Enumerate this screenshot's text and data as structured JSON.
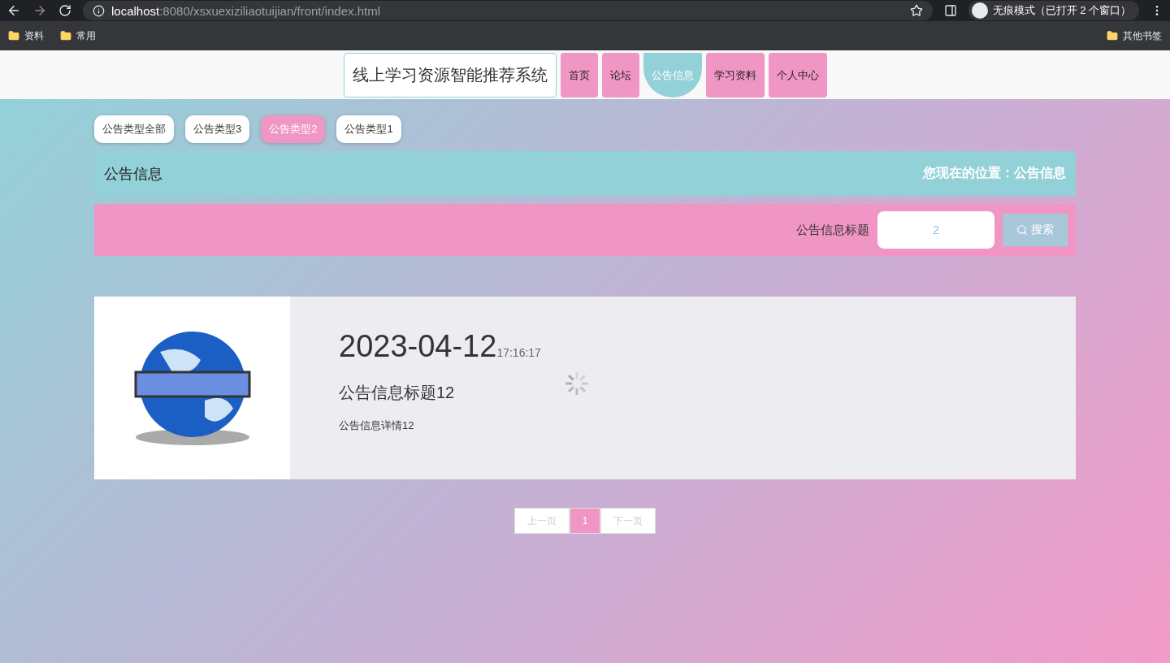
{
  "browser": {
    "url_host": "localhost",
    "url_path": ":8080/xsxuexiziliaotuijian/front/index.html",
    "incognito": "无痕模式（已打开 2 个窗口）",
    "bookmarks": [
      "资料",
      "常用"
    ],
    "other_bookmarks": "其他书签"
  },
  "nav": {
    "site_title": "线上学习资源智能推荐系统",
    "items": [
      {
        "label": "首页",
        "selected": false
      },
      {
        "label": "论坛",
        "selected": false
      },
      {
        "label": "公告信息",
        "selected": true
      },
      {
        "label": "学习资料",
        "selected": false
      },
      {
        "label": "个人中心",
        "selected": false
      }
    ]
  },
  "filters": [
    {
      "label": "公告类型全部",
      "selected": false
    },
    {
      "label": "公告类型3",
      "selected": false
    },
    {
      "label": "公告类型2",
      "selected": true
    },
    {
      "label": "公告类型1",
      "selected": false
    }
  ],
  "breadcrumb": {
    "title": "公告信息",
    "location": "您现在的位置：公告信息"
  },
  "search": {
    "label": "公告信息标题",
    "value": "2",
    "button": "搜索"
  },
  "news": [
    {
      "date": "2023-04-12",
      "time": "17:16:17",
      "title": "公告信息标题12",
      "detail": "公告信息详情12"
    }
  ],
  "pagination": {
    "prev": "上一页",
    "pages": [
      {
        "label": "1",
        "selected": true
      }
    ],
    "next": "下一页"
  }
}
